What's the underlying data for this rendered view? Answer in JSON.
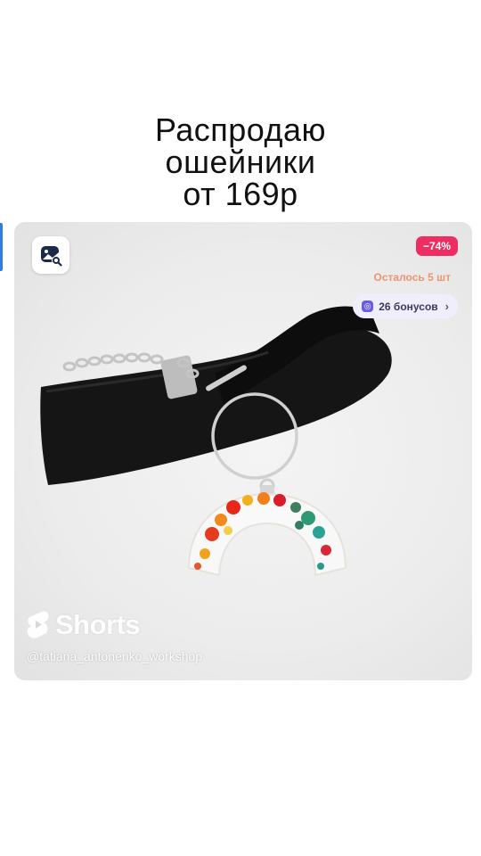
{
  "headline": {
    "line1": "Распродаю",
    "line2": "ошейники",
    "line3": "от 169р"
  },
  "product_card": {
    "discount_badge": "−74%",
    "stock_text": "Осталось 5 шт",
    "bonus_text": "26 бонусов",
    "bonus_chevron": "›",
    "shorts_brand": "Shorts",
    "channel_handle": "@tatiana_antonenko_workshop"
  },
  "icons": {
    "lens": "image-search-icon",
    "bonus": "bonus-coin-icon",
    "shorts": "shorts-logo-icon"
  },
  "colors": {
    "discount_bg": "#ee2d63",
    "stock_text": "#f19370",
    "bonus_bg": "#f1eefc",
    "lens_icon": "#1a2b4a"
  }
}
